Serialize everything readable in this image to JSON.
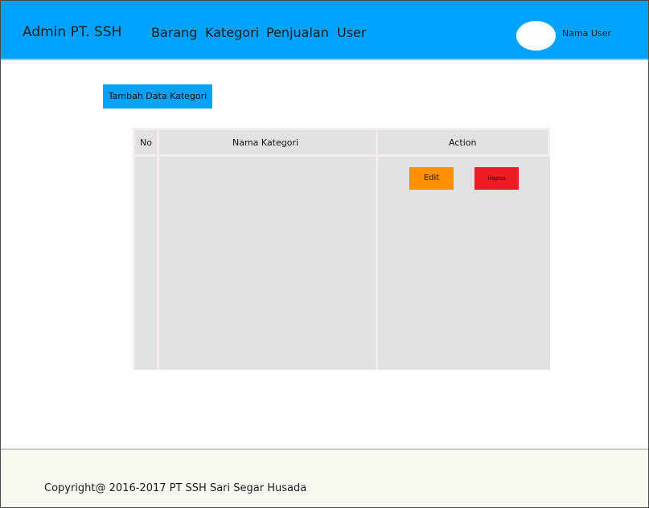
{
  "header": {
    "brand": "Admin PT. SSH",
    "nav": [
      "Barang",
      "Kategori",
      "Penjualan",
      "User"
    ],
    "user_name": "Nama User",
    "colors": {
      "header_bg": "#00a2ff",
      "avatar": "#ffffff"
    }
  },
  "main": {
    "add_button_label": "Tambah Data Kategori",
    "table": {
      "columns": [
        "No",
        "Nama Kategori",
        "Action"
      ],
      "actions": {
        "edit_label": "Edit",
        "delete_label": "Hapus"
      }
    },
    "colors": {
      "edit": "#ff8f00",
      "delete": "#ed1c24",
      "table_cell": "#e1e1e1"
    }
  },
  "footer": {
    "copyright": "Copyright@ 2016-2017 PT SSH Sari Segar Husada"
  }
}
